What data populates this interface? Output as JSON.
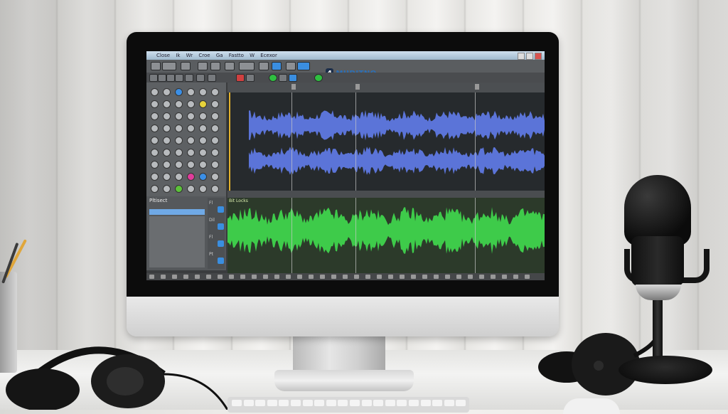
{
  "scene": {
    "description_objects": [
      "monitor",
      "audio-editor-screen",
      "microphone",
      "headphones-left",
      "headphones-right",
      "keyboard",
      "pencil-cup"
    ]
  },
  "app": {
    "menu": [
      "Close",
      "Ik",
      "Wr",
      "Croe",
      "Ga",
      "Fastto",
      "W",
      "Ecexor"
    ],
    "logo_badge": "4",
    "logo_text": "MUDITNO",
    "logo_subtitle": "TSCF PRED DEGS"
  },
  "mixer": {
    "title": "Pltisect",
    "row_labels": [
      "Fl",
      "Dil",
      "Fl",
      "Pt"
    ]
  },
  "track2": {
    "label": "Bit Locks"
  },
  "colors": {
    "waveform_top": "#5b74d8",
    "waveform_bottom": "#3ecb4a",
    "playhead_marker": "#e2b12d"
  }
}
